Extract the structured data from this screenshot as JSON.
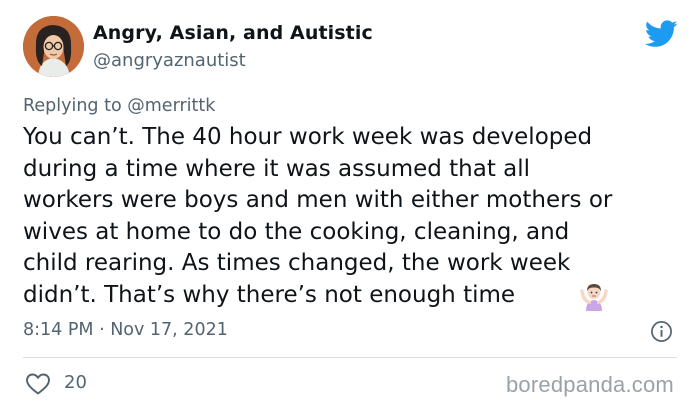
{
  "author": {
    "display_name": "Angry, Asian, and Autistic",
    "handle": "@angryaznautist"
  },
  "reply": {
    "prefix": "Replying to",
    "mention": "@merrittk"
  },
  "tweet": {
    "text": "You can’t. The 40 hour work week was developed\nduring a time where it was assumed that all\nworkers were boys and men with either mothers or\nwives at home to do the cooking, cleaning, and\nchild rearing. As times changed, the work week\ndidn’t. That’s why there’s not enough time",
    "emoji": "person-shrugging",
    "timestamp": "8:14 PM · Nov 17, 2021"
  },
  "stats": {
    "likes": "20"
  },
  "icons": {
    "platform": "twitter-bird-icon",
    "info": "info-icon",
    "like": "heart-icon"
  },
  "colors": {
    "twitter_blue": "#1d9bf0",
    "secondary_text": "#536471",
    "primary_text": "#0f1419"
  },
  "watermark": "boredpanda.com"
}
